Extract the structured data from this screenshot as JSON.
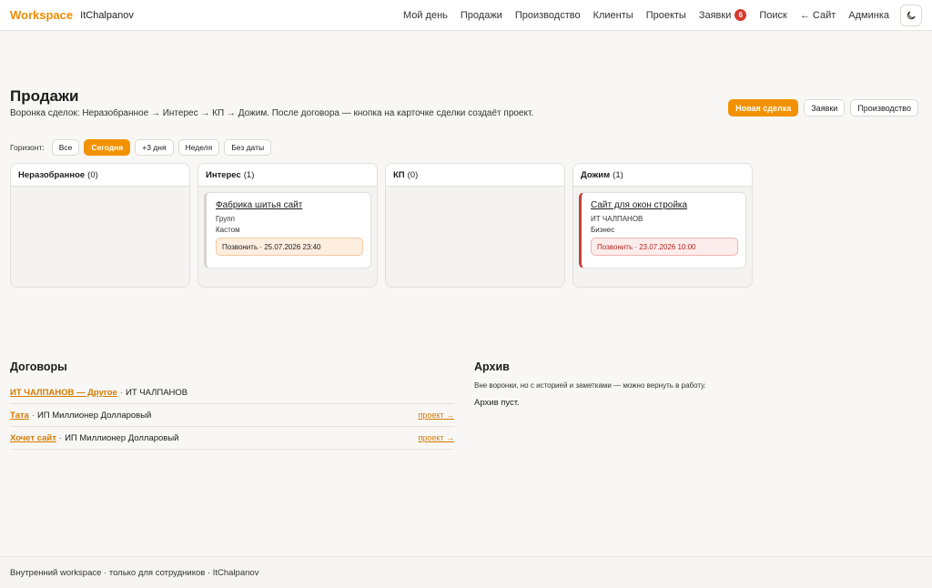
{
  "header": {
    "brand": "Workspace",
    "user": "ItChalpanov",
    "nav": [
      "Мой день",
      "Продажи",
      "Производство",
      "Клиенты",
      "Проекты"
    ],
    "requests_label": "Заявки",
    "requests_count": "6",
    "search_label": "Поиск",
    "site_label": "← Сайт",
    "admin_label": "Админка",
    "theme_icon": "moon-icon"
  },
  "page": {
    "title": "Продажи",
    "subtitle": "Воронка сделок: Неразобранное → Интерес → КП → Дожим. После договора — кнопка на карточке сделки создаёт проект.",
    "actions": {
      "new_deal": "Новая сделка",
      "requests": "Заявки",
      "production": "Производство"
    }
  },
  "horizon": {
    "label": "Горизонт:",
    "options": [
      "Все",
      "Сегодня",
      "+3 дня",
      "Неделя",
      "Без даты"
    ],
    "selected": "Сегодня"
  },
  "board": {
    "columns": [
      {
        "name": "Неразобранное",
        "count": "(0)"
      },
      {
        "name": "Интерес",
        "count": "(1)"
      },
      {
        "name": "КП",
        "count": "(0)"
      },
      {
        "name": "Дожим",
        "count": "(1)"
      }
    ],
    "cards": {
      "interest": {
        "title": "Фабрика шитья сайт",
        "client": "Групп",
        "type": "Кастом",
        "task": "Позвонить · 25.07.2026 23:40"
      },
      "closing": {
        "title": "Сайт для окон стройка",
        "client": "ИТ ЧАЛПАНОВ",
        "type": "Бизнес",
        "task": "Позвонить · 23.07.2026 10:00"
      }
    }
  },
  "contracts": {
    "title": "Договоры",
    "rows": [
      {
        "link": "ИТ ЧАЛПАНОВ — Другое",
        "client": "ИТ ЧАЛПАНОВ",
        "project": ""
      },
      {
        "link": "Тата",
        "client": "ИП Миллионер Долларовый",
        "project": "проект →"
      },
      {
        "link": "Хочет сайт",
        "client": "ИП Миллионер Долларовый",
        "project": "проект →"
      }
    ]
  },
  "archive": {
    "title": "Архив",
    "subtitle": "Вне воронки, но с историей и заметками — можно вернуть в работу.",
    "empty": "Архив пуст."
  },
  "footer": {
    "text": "Внутренний workspace · только для сотрудников · ItChalpanov"
  },
  "colors": {
    "accent": "#f39200",
    "danger": "#c9413a",
    "badge": "#d63a2f"
  }
}
